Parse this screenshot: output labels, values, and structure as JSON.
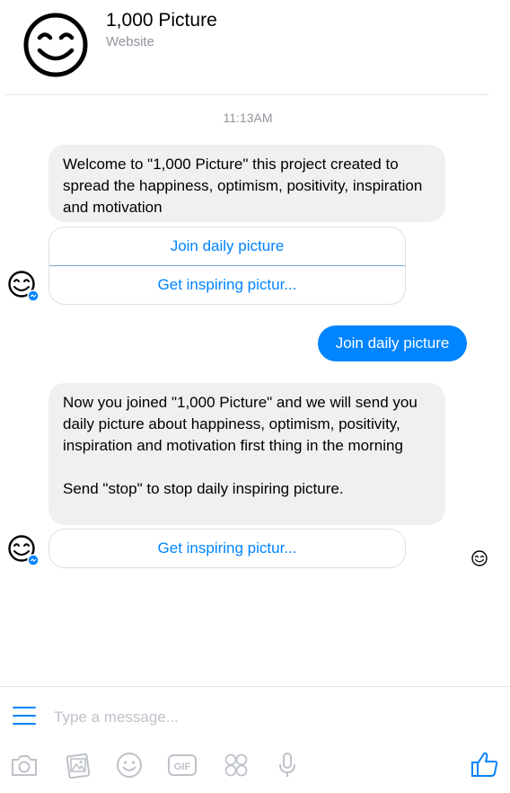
{
  "header": {
    "title": "1,000 Picture",
    "subtitle": "Website",
    "avatar_icon": "smiley-face-icon"
  },
  "conversation": {
    "timestamp": "11:13AM",
    "messages": [
      {
        "from": "bot",
        "text": "Welcome to \"1,000 Picture\" this project created to spread the happiness, optimism, positivity, inspiration and motivation",
        "quick_replies": [
          "Join daily picture",
          "Get inspiring pictur..."
        ]
      },
      {
        "from": "user",
        "text": "Join daily picture"
      },
      {
        "from": "bot",
        "paragraphs": [
          "Now you joined \"1,000 Picture\" and we will send you daily picture about happiness, optimism, positivity, inspiration and motivation first thing in the morning",
          "Send \"stop\" to stop daily inspiring picture."
        ],
        "quick_replies": [
          "Get inspiring pictur..."
        ]
      }
    ]
  },
  "composer": {
    "placeholder": "Type a message...",
    "icons": [
      "menu-icon",
      "camera-icon",
      "gallery-icon",
      "emoji-icon",
      "gif-icon",
      "stickers-icon",
      "microphone-icon",
      "thumbs-up-icon"
    ]
  },
  "colors": {
    "accent": "#0084ff",
    "bubble_incoming": "#f1f0f0",
    "muted_text": "#90949c",
    "toolbar_icon": "#bec2c9"
  }
}
